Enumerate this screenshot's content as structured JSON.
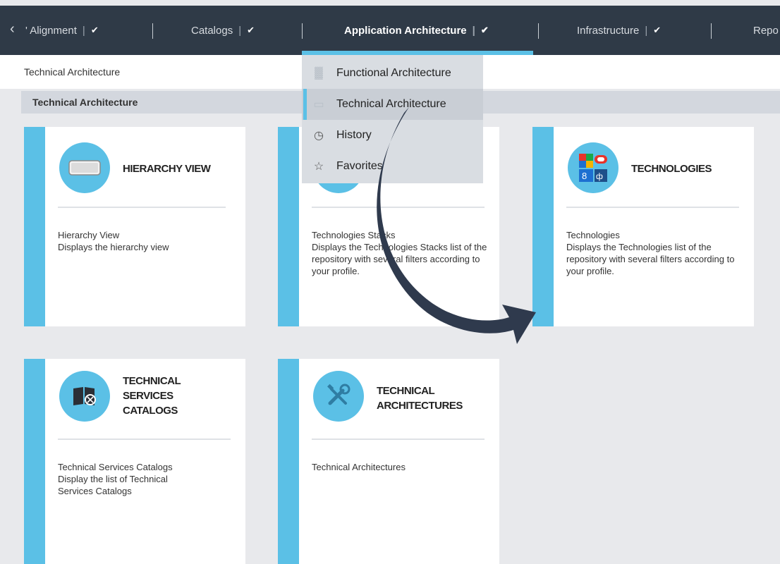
{
  "nav": {
    "back_icon": "chevron-left-icon",
    "items": [
      {
        "label": "' Alignment"
      },
      {
        "label": "Catalogs"
      },
      {
        "label": "Application Architecture"
      },
      {
        "label": "Infrastructure"
      },
      {
        "label": "Repo"
      }
    ],
    "accent_color": "#5bc0e6"
  },
  "breadcrumb": "Technical Architecture",
  "section": {
    "title": "Technical Architecture"
  },
  "dropdown": {
    "items": [
      {
        "label": "Functional Architecture",
        "icon": "building-icon"
      },
      {
        "label": "Technical Architecture",
        "icon": "server-icon",
        "selected": true
      },
      {
        "label": "History",
        "icon": "clock-icon"
      },
      {
        "label": "Favorites",
        "icon": "star-icon"
      }
    ]
  },
  "cards": [
    {
      "title": "HIERARCHY VIEW",
      "desc1": "Hierarchy View",
      "desc2": "Displays the hierarchy view",
      "icon": "hierarchy-icon"
    },
    {
      "title": "",
      "desc1": "Technologies Stacks",
      "desc2": "Displays the Technologies Stacks list of the repository with several filters according to your profile.",
      "icon": "stack-icon"
    },
    {
      "title": "TECHNOLOGIES",
      "desc1": "Technologies",
      "desc2": "Displays the Technologies list of the repository with several filters according to your profile.",
      "icon": "technologies-icon"
    },
    {
      "title_l1": "TECHNICAL",
      "title_l2": "SERVICES",
      "title_l3": "CATALOGS",
      "desc1": "Technical Services Catalogs",
      "desc2": "Display the list of Technical Services Catalogs",
      "icon": "book-icon"
    },
    {
      "title_l1": "TECHNICAL",
      "title_l2": "ARCHITECTURES",
      "desc1": "Technical Architectures",
      "icon": "tools-icon"
    }
  ]
}
